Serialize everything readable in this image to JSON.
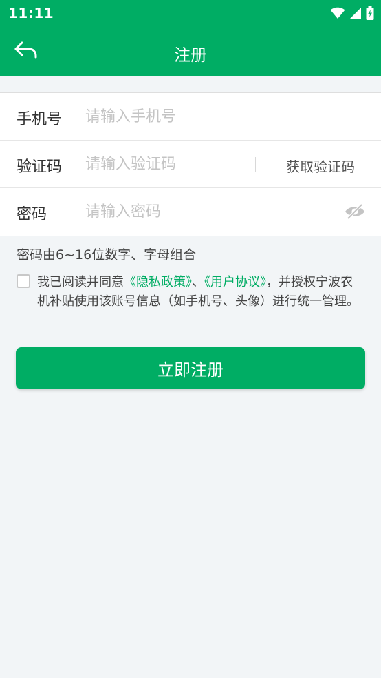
{
  "status_bar": {
    "time": "11:11",
    "icons": [
      "wifi-icon",
      "cellular-signal-icon",
      "battery-charging-icon"
    ]
  },
  "app_bar": {
    "title": "注册",
    "back_icon": "back-arrow-icon"
  },
  "form": {
    "phone": {
      "label": "手机号",
      "placeholder": "请输入手机号",
      "value": ""
    },
    "code": {
      "label": "验证码",
      "placeholder": "请输入验证码",
      "value": "",
      "button": "获取验证码"
    },
    "password": {
      "label": "密码",
      "placeholder": "请输入密码",
      "value": "",
      "toggle_icon": "eye-hidden-icon"
    }
  },
  "hint": "密码由6~16位数字、字母组合",
  "agreement": {
    "checked": false,
    "prefix": "我已阅读并同意",
    "privacy_link": "《隐私政策》",
    "separator": "、",
    "user_link": "《用户协议》",
    "suffix": "，并授权宁波农机补贴使用该账号信息（如手机号、头像）进行统一管理。"
  },
  "register_button": "立即注册",
  "colors": {
    "primary": "#00ad64",
    "background": "#f2f5f7",
    "placeholder": "#c4c4c4"
  }
}
